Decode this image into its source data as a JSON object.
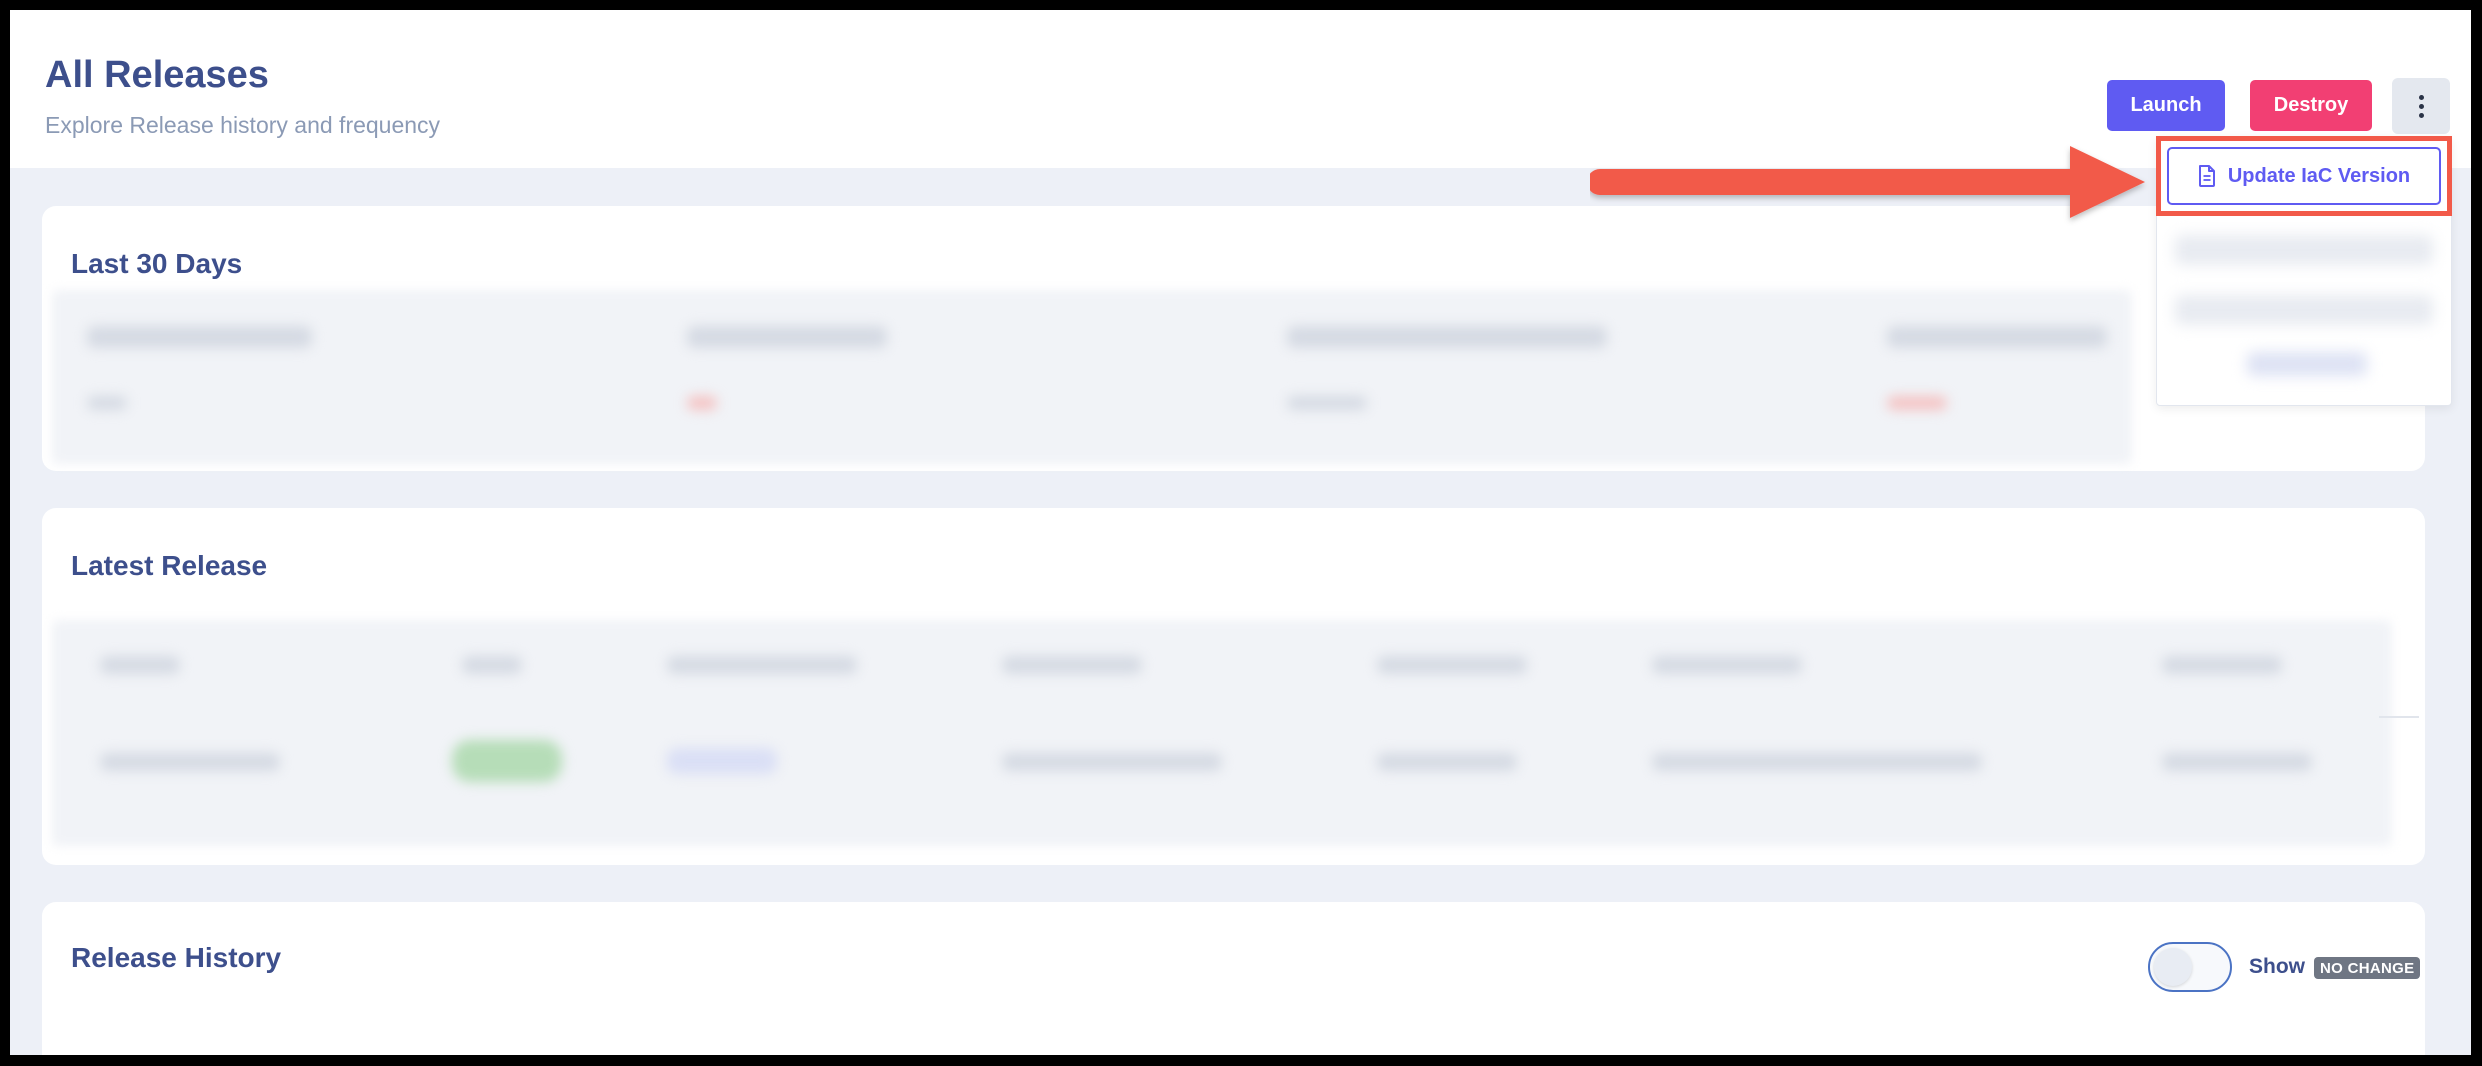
{
  "header": {
    "title": "All Releases",
    "subtitle": "Explore Release history and frequency"
  },
  "actions": {
    "launch_label": "Launch",
    "destroy_label": "Destroy"
  },
  "dropdown": {
    "item_label": "Update IaC Version",
    "item_icon": "file-document-icon"
  },
  "sections": {
    "last30_title": "Last 30 Days",
    "latest_title": "Latest Release",
    "history_title": "Release History"
  },
  "history": {
    "toggle_label": "Show",
    "badge_text": "NO CHANGE"
  },
  "colors": {
    "accent": "#5f5bf2",
    "danger": "#f23f73",
    "annotation": "#f25a49",
    "heading": "#3d4f8c"
  }
}
